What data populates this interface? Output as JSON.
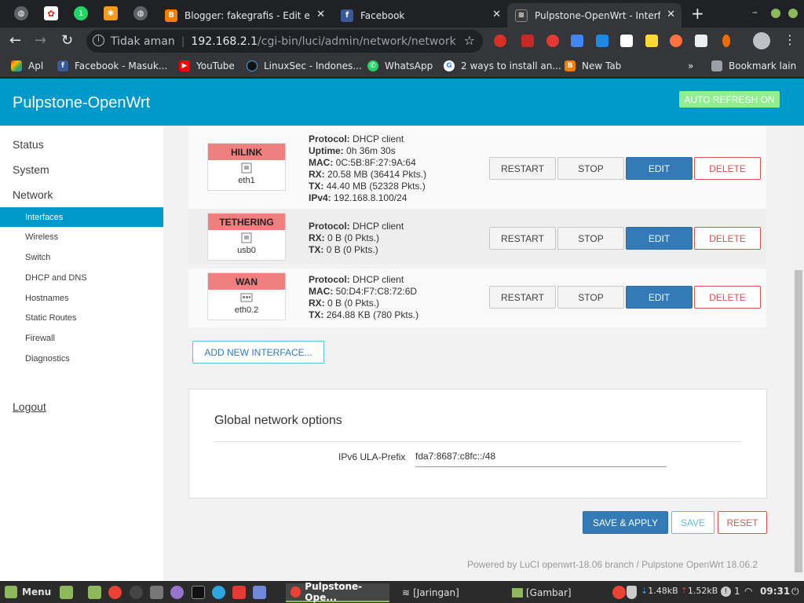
{
  "browser": {
    "tabs": [
      {
        "label": "Blogger: fakegrafis - Edit ent",
        "icon": "blogger-icon"
      },
      {
        "label": "Facebook",
        "icon": "facebook-icon"
      },
      {
        "label": "Pulpstone-OpenWrt - Interfa",
        "icon": "router-icon",
        "active": true
      }
    ],
    "address": {
      "security": "Tidak aman",
      "host": "192.168.2.1",
      "path": "/cgi-bin/luci/admin/network/network"
    },
    "bookmarks": [
      {
        "label": "Apl",
        "icon": "apps-icon"
      },
      {
        "label": "Facebook - Masuk...",
        "icon": "facebook-icon"
      },
      {
        "label": "YouTube",
        "icon": "youtube-icon"
      },
      {
        "label": "LinuxSec - Indones...",
        "icon": "linuxsec-icon"
      },
      {
        "label": "WhatsApp",
        "icon": "whatsapp-icon"
      },
      {
        "label": "2 ways to install an...",
        "icon": "google-icon"
      },
      {
        "label": "New Tab",
        "icon": "blogger-icon"
      }
    ],
    "bookmarks_overflow": "»",
    "other_bookmarks": "Bookmark lain"
  },
  "app": {
    "brand": "Pulpstone-OpenWrt",
    "auto_refresh": "AUTO REFRESH ON"
  },
  "sidebar": {
    "main": [
      "Status",
      "System",
      "Network"
    ],
    "sub": [
      "Interfaces",
      "Wireless",
      "Switch",
      "DHCP and DNS",
      "Hostnames",
      "Static Routes",
      "Firewall",
      "Diagnostics"
    ],
    "active_sub": "Interfaces",
    "logout": "Logout"
  },
  "interfaces": [
    {
      "name": "HILINK",
      "device": "eth1",
      "icon": "ethernet-port-icon",
      "lines": [
        {
          "k": "Protocol:",
          "v": "DHCP client"
        },
        {
          "k": "Uptime:",
          "v": "0h 36m 30s"
        },
        {
          "k": "MAC:",
          "v": "0C:5B:8F:27:9A:64"
        },
        {
          "k": "RX:",
          "v": "20.58 MB (36414 Pkts.)"
        },
        {
          "k": "TX:",
          "v": "44.40 MB (52328 Pkts.)"
        },
        {
          "k": "IPv4:",
          "v": "192.168.8.100/24"
        }
      ]
    },
    {
      "name": "TETHERING",
      "device": "usb0",
      "icon": "ethernet-port-icon",
      "lines": [
        {
          "k": "Protocol:",
          "v": "DHCP client"
        },
        {
          "k": "RX:",
          "v": "0 B (0 Pkts.)"
        },
        {
          "k": "TX:",
          "v": "0 B (0 Pkts.)"
        }
      ]
    },
    {
      "name": "WAN",
      "device": "eth0.2",
      "icon": "switch-port-icon",
      "lines": [
        {
          "k": "Protocol:",
          "v": "DHCP client"
        },
        {
          "k": "MAC:",
          "v": "50:D4:F7:C8:72:6D"
        },
        {
          "k": "RX:",
          "v": "0 B (0 Pkts.)"
        },
        {
          "k": "TX:",
          "v": "264.88 KB (780 Pkts.)"
        }
      ]
    }
  ],
  "buttons": {
    "restart": "RESTART",
    "stop": "STOP",
    "edit": "EDIT",
    "delete": "DELETE"
  },
  "add_interface": "ADD NEW INTERFACE...",
  "global": {
    "title": "Global network options",
    "ula_label": "IPv6 ULA-Prefix",
    "ula_value": "fda7:8687:c8fc::/48"
  },
  "actions": {
    "save_apply": "SAVE & APPLY",
    "save": "SAVE",
    "reset": "RESET"
  },
  "footer": "Powered by LuCI openwrt-18.06 branch / Pulpstone OpenWrt 18.06.2",
  "taskbar": {
    "menu": "Menu",
    "tasks": [
      {
        "label": "Pulpstone-Ope...",
        "icon": "chrome-icon",
        "active": true
      },
      {
        "label": "[Jaringan]",
        "icon": "network-icon"
      },
      {
        "label": "[Gambar]",
        "icon": "folder-icon"
      }
    ],
    "net_down": "1.48kB",
    "net_up": "1.52kB",
    "notifications": "1",
    "clock": "09:31"
  },
  "colors": {
    "brand": "#0099cc",
    "auto_refresh": "#90ee90",
    "badge": "#f08080",
    "edit": "#337ab7",
    "delete": "#d9534f"
  }
}
